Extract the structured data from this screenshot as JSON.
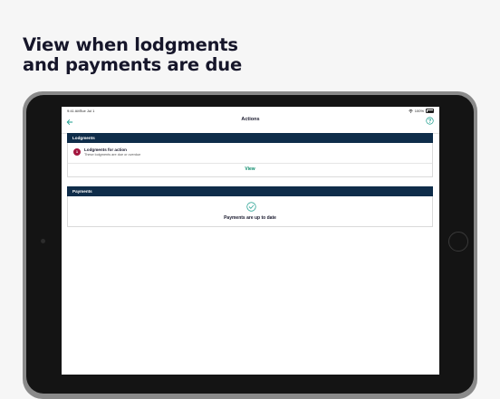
{
  "headline": {
    "line1": "View when lodgments",
    "line2": "and payments are due"
  },
  "status_bar": {
    "time": "9:41 AM",
    "date": "Tue Jul 1",
    "battery": "100%"
  },
  "navbar": {
    "title": "Actions",
    "back_icon": "arrow-left-icon",
    "help_icon": "question-circle-icon"
  },
  "lodgments": {
    "header": "Lodgments",
    "badge_count": "1",
    "item_title": "Lodgments for action",
    "item_subtitle": "These lodgments are due or overdue",
    "view_label": "View"
  },
  "payments": {
    "header": "Payments",
    "status_icon": "check-circle-icon",
    "status_text": "Payments are up to date"
  },
  "colors": {
    "header_navy": "#0f2d4a",
    "badge_red": "#a3173f",
    "link_green": "#0a8a6a",
    "accent_teal": "#1a9c8c"
  }
}
